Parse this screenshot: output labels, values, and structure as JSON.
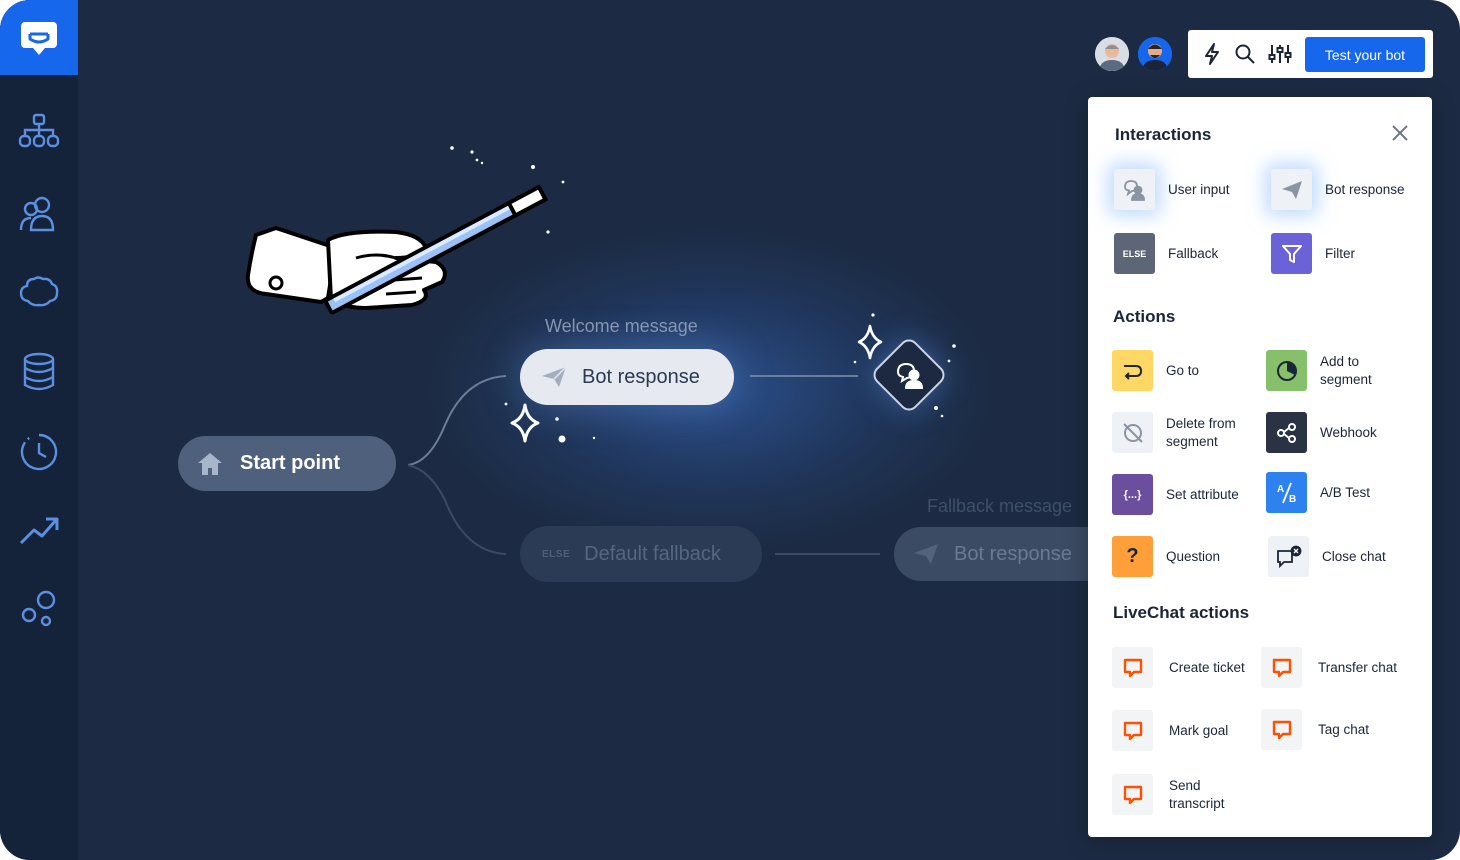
{
  "toolbar": {
    "test_bot_label": "Test your bot"
  },
  "canvas": {
    "start_label": "Start point",
    "welcome_label": "Welcome message",
    "bot_response_label": "Bot response",
    "fallback_node_tag": "ELSE",
    "fallback_node_label": "Default fallback",
    "fallback_message_label": "Fallback message",
    "bot_response_2_label": "Bot response"
  },
  "panel": {
    "interactions_title": "Interactions",
    "actions_title": "Actions",
    "livechat_title": "LiveChat actions",
    "interactions": [
      "User input",
      "Bot response",
      "Fallback",
      "Filter"
    ],
    "fallback_tag": "ELSE",
    "actions": [
      "Go to",
      "Add to segment",
      "Delete from segment",
      "Webhook",
      "Set attribute",
      "A/B Test",
      "Question",
      "Close chat"
    ],
    "set_attribute_icon_text": "{...}",
    "question_icon_text": "?",
    "livechat": [
      "Create ticket",
      "Transfer chat",
      "Mark goal",
      "Tag chat",
      "Send transcript"
    ]
  },
  "colors": {
    "accent": "#1667ec",
    "background": "#1c2b43",
    "sidebar": "#15233a",
    "livechat_orange": "#ff5100",
    "filter_purple": "#6b62d8",
    "goto_yellow": "#ffd764",
    "segment_green": "#86c06b",
    "attribute_purple": "#6b4f9e",
    "question_orange": "#ff9f3a",
    "ab_blue": "#2e82f0"
  },
  "icons": {
    "sidebar": [
      "chatbot-logo-icon",
      "flow-tree-icon",
      "users-icon",
      "brain-icon",
      "database-icon",
      "history-clock-icon",
      "analytics-trend-icon",
      "integrations-icon"
    ],
    "toolbar": [
      "lightning-icon",
      "search-icon",
      "sliders-icon"
    ]
  }
}
